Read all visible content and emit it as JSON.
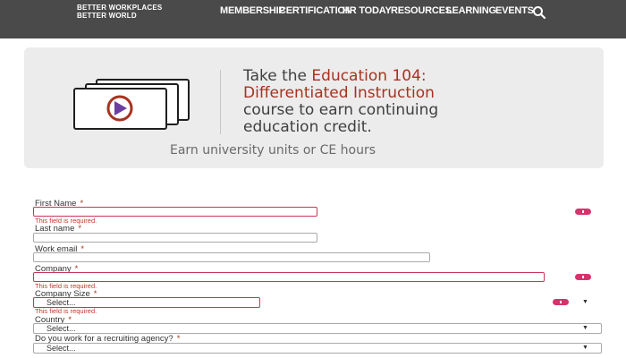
{
  "header": {
    "logo_line1": "BETTER WORKPLACES",
    "logo_line2": "BETTER WORLD",
    "nav": [
      "MEMBERSHIP",
      "CERTIFICATION",
      "HR TODAY",
      "RESOURCES",
      "LEARNING",
      "EVENTS"
    ],
    "search_icon": "search-icon"
  },
  "promo": {
    "line1_prefix": "Take the ",
    "line1_highlight": "Education 104:",
    "line2_highlight": "Differentiated Instruction",
    "line3": "course to earn continuing",
    "line4": "education credit.",
    "subtext": "Earn university units or CE hours",
    "icon": "video-stack-icon"
  },
  "form": {
    "first_name_label": "First Name",
    "first_name_error": "This field is required.",
    "last_name_label": "Last name",
    "work_email_label": "Work email",
    "company_label": "Company",
    "company_error": "This field is required.",
    "company_size_label": "Company Size",
    "company_size_value": "Select...",
    "company_size_error": "This field is required.",
    "country_label": "Country",
    "country_value": "Select...",
    "recruiting_label": "Do you work for a recruiting agency?",
    "recruiting_value": "Select...",
    "required_mark": "*"
  },
  "colors": {
    "topbar": "#4a4a4a",
    "accent": "#a8321f",
    "error": "#d6336c"
  }
}
